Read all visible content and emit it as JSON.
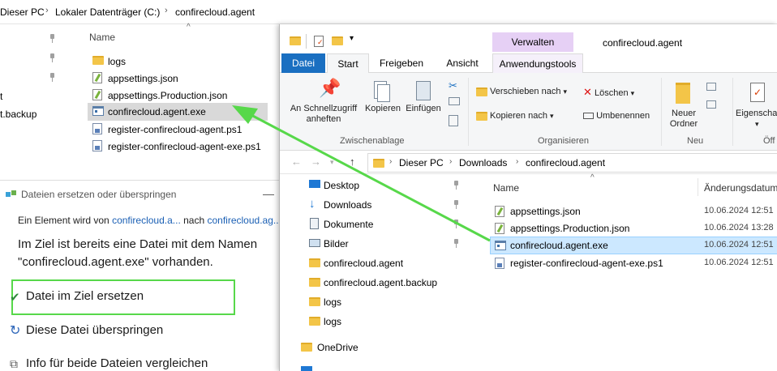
{
  "background_explorer": {
    "breadcrumbs": [
      "Dieser PC",
      "Lokaler Datenträger (C:)",
      "confirecloud.agent"
    ],
    "nav_partial": [
      "t",
      "t.backup"
    ],
    "column_name": "Name",
    "files": [
      {
        "name": "logs",
        "icon": "folder-icon"
      },
      {
        "name": "appsettings.json",
        "icon": "json-file-icon"
      },
      {
        "name": "appsettings.Production.json",
        "icon": "json-file-icon"
      },
      {
        "name": "confirecloud.agent.exe",
        "icon": "exe-file-icon",
        "selected": true
      },
      {
        "name": "register-confirecloud-agent.ps1",
        "icon": "ps1-file-icon"
      },
      {
        "name": "register-confirecloud-agent-exe.ps1",
        "icon": "ps1-file-icon"
      }
    ]
  },
  "dialog": {
    "title": "Dateien ersetzen oder überspringen",
    "minimize": "—",
    "line1_prefix": "Ein Element wird von ",
    "line1_src": "confirecloud.a...",
    "line1_mid": " nach ",
    "line1_dst": "confirecloud.ag...",
    "message": "Im Ziel ist bereits eine Datei mit dem Namen \"confirecloud.agent.exe\" vorhanden.",
    "options": {
      "replace": "Datei im Ziel ersetzen",
      "skip": "Diese Datei überspringen",
      "compare": "Info für beide Dateien vergleichen"
    }
  },
  "window": {
    "title": "confirecloud.agent",
    "context_header": "Verwalten",
    "tabs": {
      "datei": "Datei",
      "start": "Start",
      "freigeben": "Freigeben",
      "ansicht": "Ansicht",
      "anwendungstools": "Anwendungstools"
    },
    "ribbon": {
      "pin_line1": "An Schnellzugriff",
      "pin_line2": "anheften",
      "copy": "Kopieren",
      "paste": "Einfügen",
      "move_to": "Verschieben nach",
      "copy_to": "Kopieren nach",
      "delete": "Löschen",
      "rename": "Umbenennen",
      "new_folder_line1": "Neuer",
      "new_folder_line2": "Ordner",
      "properties": "Eigenscha",
      "group_clipboard": "Zwischenablage",
      "group_organize": "Organisieren",
      "group_new": "Neu",
      "group_open": "Öff"
    },
    "breadcrumbs": [
      "Dieser PC",
      "Downloads",
      "confirecloud.agent"
    ],
    "nav_items": [
      {
        "label": "Desktop",
        "icon": "desktop-icon",
        "pinned": true
      },
      {
        "label": "Downloads",
        "icon": "download-icon",
        "pinned": true
      },
      {
        "label": "Dokumente",
        "icon": "documents-icon",
        "pinned": true
      },
      {
        "label": "Bilder",
        "icon": "pictures-icon",
        "pinned": true
      },
      {
        "label": "confirecloud.agent",
        "icon": "folder-icon"
      },
      {
        "label": "confirecloud.agent.backup",
        "icon": "folder-icon"
      },
      {
        "label": "logs",
        "icon": "folder-icon"
      },
      {
        "label": "logs",
        "icon": "folder-icon"
      }
    ],
    "onedrive": "OneDrive",
    "columns": {
      "name": "Name",
      "date": "Änderungsdatum"
    },
    "files": [
      {
        "name": "appsettings.json",
        "date": "10.06.2024 12:51",
        "icon": "json-file-icon"
      },
      {
        "name": "appsettings.Production.json",
        "date": "10.06.2024 13:28",
        "icon": "json-file-icon"
      },
      {
        "name": "confirecloud.agent.exe",
        "date": "10.06.2024 12:51",
        "icon": "exe-file-icon",
        "selected": true
      },
      {
        "name": "register-confirecloud-agent-exe.ps1",
        "date": "10.06.2024 12:51",
        "icon": "ps1-file-icon"
      }
    ]
  },
  "colors": {
    "accent": "#1a6fc1",
    "highlight": "#57d84a",
    "selection": "#cce8ff",
    "context_tab": "#e6d0f5"
  }
}
